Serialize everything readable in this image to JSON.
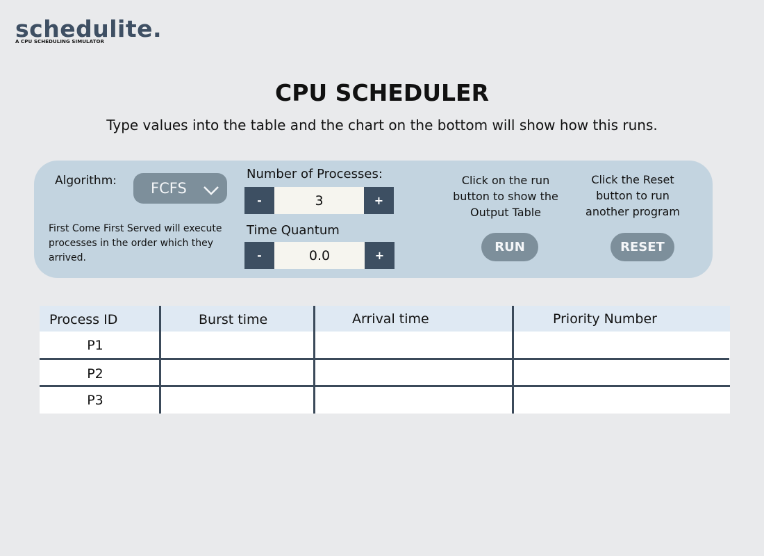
{
  "brand": {
    "name": "schedulite.",
    "tagline": "A CPU SCHEDULING SIMULATOR"
  },
  "header": {
    "title": "CPU SCHEDULER",
    "subtitle": "Type values into the table and the chart on the bottom will show how this runs."
  },
  "controls": {
    "algorithm_label": "Algorithm:",
    "algorithm_value": "FCFS",
    "algorithm_description": "First Come First Served will execute processes in the order which they arrived.",
    "processes_label": "Number of Processes:",
    "processes_value": "3",
    "quantum_label": "Time Quantum",
    "quantum_value": "0.0",
    "minus": "-",
    "plus": "+",
    "run_help": "Click on the run button to show the Output Table",
    "run_label": "RUN",
    "reset_help": "Click the Reset button to run another program",
    "reset_label": "RESET"
  },
  "table": {
    "columns": [
      "Process ID",
      "Burst time",
      "Arrival time",
      "Priority Number"
    ],
    "rows": [
      {
        "id": "P1",
        "burst": "",
        "arrival": "",
        "priority": ""
      },
      {
        "id": "P2",
        "burst": "",
        "arrival": "",
        "priority": ""
      },
      {
        "id": "P3",
        "burst": "",
        "arrival": "",
        "priority": ""
      }
    ]
  },
  "colors": {
    "brand": "#3e4f63",
    "panel": "#c3d4e0",
    "stepper_button": "#3d4f62",
    "pill_button": "#7d8f9b",
    "table_header": "#dfe9f3"
  },
  "icons": {
    "dropdown": "chevron-down-icon"
  }
}
